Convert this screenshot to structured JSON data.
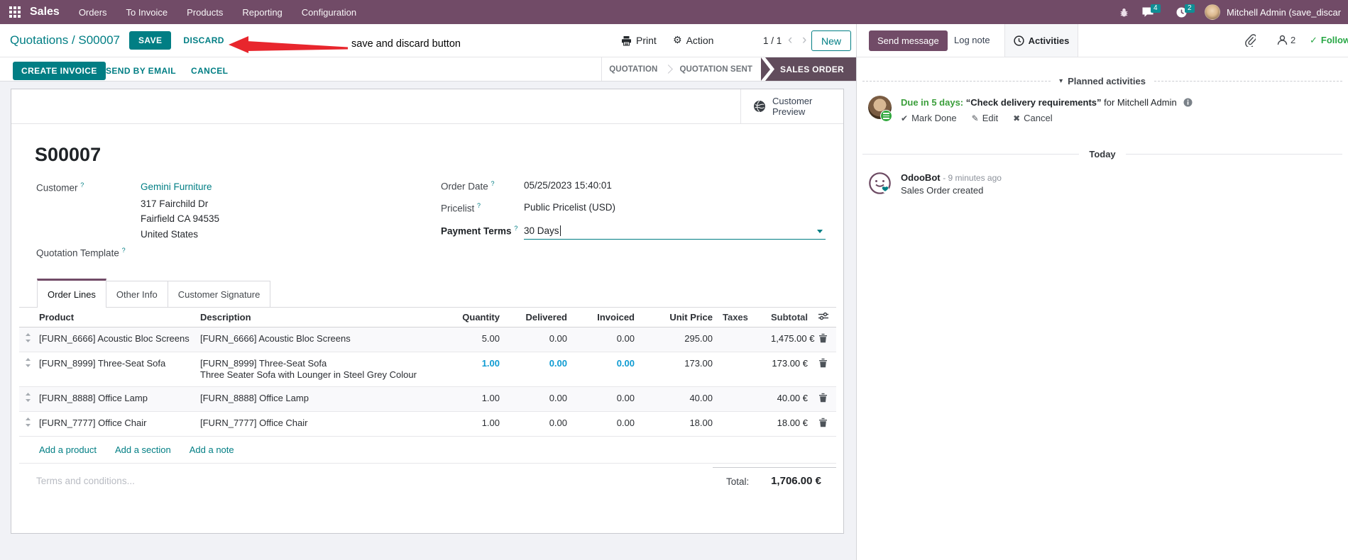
{
  "navbar": {
    "brand": "Sales",
    "menus": [
      "Orders",
      "To Invoice",
      "Products",
      "Reporting",
      "Configuration"
    ],
    "messages_badge": "4",
    "activities_badge": "2",
    "user": "Mitchell Admin (save_discar"
  },
  "breadcrumb": {
    "path": "Quotations / S00007",
    "save_label": "SAVE",
    "discard_label": "DISCARD"
  },
  "annotation": {
    "label": "save and discard button",
    "arrow_color": "#e8262d"
  },
  "controls": {
    "print_label": "Print",
    "action_label": "Action",
    "pager": "1 / 1",
    "new_label": "New"
  },
  "actions": {
    "create_invoice": "CREATE INVOICE",
    "send_by_email": "SEND BY EMAIL",
    "cancel": "CANCEL"
  },
  "statusbar": {
    "stages": [
      "QUOTATION",
      "QUOTATION SENT",
      "SALES ORDER"
    ],
    "active_stage": "SALES ORDER"
  },
  "sheet": {
    "preview_button": {
      "line1": "Customer",
      "line2": "Preview"
    },
    "title": "S00007",
    "fields": {
      "customer_label": "Customer",
      "customer_value": "Gemini Furniture",
      "customer_address": [
        "317 Fairchild Dr",
        "Fairfield CA 94535",
        "United States"
      ],
      "quotation_template_label": "Quotation Template",
      "order_date_label": "Order Date",
      "order_date_value": "05/25/2023 15:40:01",
      "pricelist_label": "Pricelist",
      "pricelist_value": "Public Pricelist (USD)",
      "payment_terms_label": "Payment Terms",
      "payment_terms_value": "30 Days"
    },
    "tabs": [
      {
        "label": "Order Lines",
        "active": true
      },
      {
        "label": "Other Info",
        "active": false
      },
      {
        "label": "Customer Signature",
        "active": false
      }
    ],
    "order_lines": {
      "headers": {
        "product": "Product",
        "description": "Description",
        "quantity": "Quantity",
        "delivered": "Delivered",
        "invoiced": "Invoiced",
        "unit_price": "Unit Price",
        "taxes": "Taxes",
        "subtotal": "Subtotal"
      },
      "rows": [
        {
          "product": "[FURN_6666] Acoustic Bloc Screens",
          "description": [
            "[FURN_6666] Acoustic Bloc Screens"
          ],
          "quantity": "5.00",
          "delivered": "0.00",
          "invoiced": "0.00",
          "unit_price": "295.00",
          "taxes": "",
          "subtotal": "1,475.00 €",
          "highlighted": false
        },
        {
          "product": "[FURN_8999] Three-Seat Sofa",
          "description": [
            "[FURN_8999] Three-Seat Sofa",
            "Three Seater Sofa with Lounger in Steel Grey Colour"
          ],
          "quantity": "1.00",
          "delivered": "0.00",
          "invoiced": "0.00",
          "unit_price": "173.00",
          "taxes": "",
          "subtotal": "173.00 €",
          "highlighted": true
        },
        {
          "product": "[FURN_8888] Office Lamp",
          "description": [
            "[FURN_8888] Office Lamp"
          ],
          "quantity": "1.00",
          "delivered": "0.00",
          "invoiced": "0.00",
          "unit_price": "40.00",
          "taxes": "",
          "subtotal": "40.00 €",
          "highlighted": false
        },
        {
          "product": "[FURN_7777] Office Chair",
          "description": [
            "[FURN_7777] Office Chair"
          ],
          "quantity": "1.00",
          "delivered": "0.00",
          "invoiced": "0.00",
          "unit_price": "18.00",
          "taxes": "",
          "subtotal": "18.00 €",
          "highlighted": false
        }
      ],
      "footer_links": [
        "Add a product",
        "Add a section",
        "Add a note"
      ]
    },
    "terms_placeholder": "Terms and conditions...",
    "total_label": "Total:",
    "total_value": "1,706.00 €"
  },
  "chatter": {
    "send_message": "Send message",
    "log_note": "Log note",
    "activities_tab": "Activities",
    "followers_count": "2",
    "following_label": "Following",
    "planned_activities_header": "Planned activities",
    "activity": {
      "due": "Due in 5 days:",
      "title": "“Check delivery requirements”",
      "assignee": "for Mitchell Admin",
      "mark_done": "Mark Done",
      "edit": "Edit",
      "cancel": "Cancel"
    },
    "date_divider": "Today",
    "message": {
      "author": "OdooBot",
      "timestamp": "- 9 minutes ago",
      "body": "Sales Order created"
    }
  },
  "colors": {
    "brand": "#714B67",
    "primary": "#017E84",
    "stage_active": "#614c5c",
    "highlight_blue": "#0e9bd2",
    "due_green": "#3a9e3a",
    "following_green": "#28a745",
    "annotation_red": "#e8262d"
  }
}
